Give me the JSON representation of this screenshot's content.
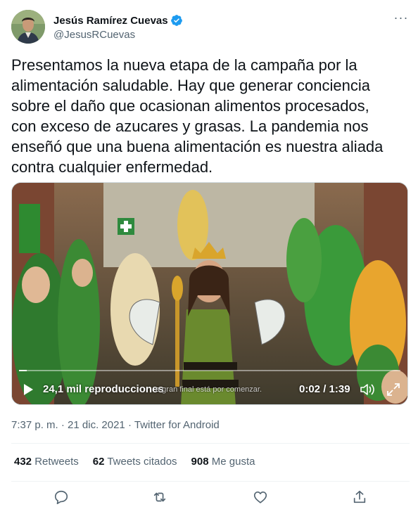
{
  "author": {
    "display_name": "Jesús Ramírez Cuevas",
    "handle": "@JesusRCuevas",
    "verified": true,
    "verified_color": "#1d9bf0"
  },
  "tweet": {
    "text": "Presentamos la nueva etapa de la campaña por la\nalimentación saludable. Hay que generar conciencia\nsobre el daño que ocasionan alimentos procesados,\ncon exceso de azucares y grasas. La pandemia nos\nenseñó que una buena alimentación es nuestra aliada\ncontra cualquier enfermedad."
  },
  "video": {
    "views": "24,1 mil reproducciones",
    "subtitle": "a gran final está por comenzar.",
    "time": "0:02 / 1:39",
    "progress": 0.02
  },
  "meta": {
    "time": "7:37 p. m.",
    "separator": "·",
    "date": "21 dic. 2021",
    "source": "Twitter for Android"
  },
  "stats": {
    "retweets_count": "432",
    "retweets_label": "Retweets",
    "quotes_count": "62",
    "quotes_label": "Tweets citados",
    "likes_count": "908",
    "likes_label": "Me gusta"
  },
  "icons": {
    "more": "more-dots-icon",
    "reply": "reply-icon",
    "retweet": "retweet-icon",
    "like": "heart-icon",
    "share": "share-icon",
    "play": "play-icon",
    "volume": "volume-icon",
    "fullscreen": "fullscreen-icon"
  },
  "colors": {
    "text": "#0f1419",
    "secondary": "#536471",
    "accent": "#1d9bf0"
  }
}
